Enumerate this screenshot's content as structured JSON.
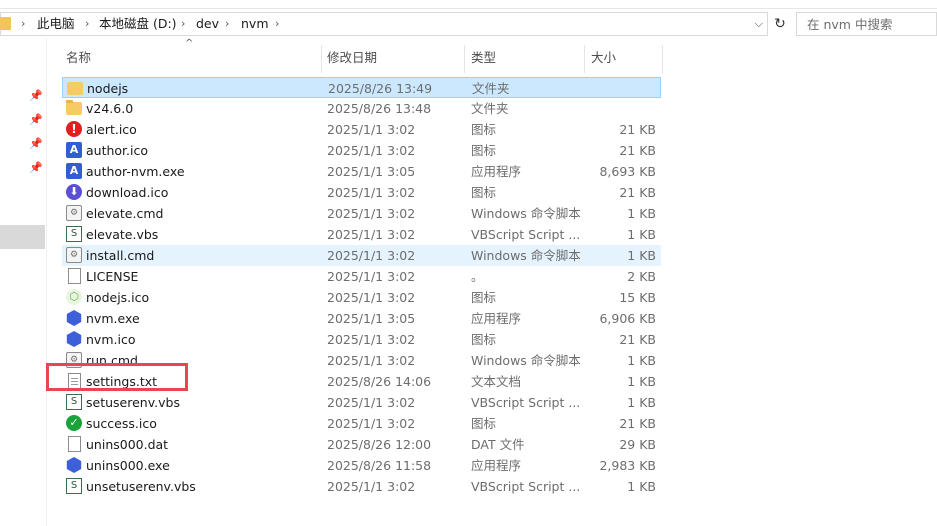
{
  "address": {
    "crumbs": [
      "此电脑",
      "本地磁盘 (D:)",
      "dev",
      "nvm"
    ],
    "separator": "›",
    "dropdown": "⌵"
  },
  "refresh_glyph": "↻",
  "search": {
    "placeholder": "在 nvm 中搜索"
  },
  "columns": {
    "name": "名称",
    "date": "修改日期",
    "type": "类型",
    "size": "大小"
  },
  "files": [
    {
      "name": "nodejs",
      "date": "2025/8/26 13:49",
      "type": "文件夹",
      "size": "",
      "icon": "folder-shortcut-icon",
      "state": "selected"
    },
    {
      "name": "v24.6.0",
      "date": "2025/8/26 13:48",
      "type": "文件夹",
      "size": "",
      "icon": "folder-icon",
      "state": ""
    },
    {
      "name": "alert.ico",
      "date": "2025/1/1 3:02",
      "type": "图标",
      "size": "21 KB",
      "icon": "alert-icon",
      "state": ""
    },
    {
      "name": "author.ico",
      "date": "2025/1/1 3:02",
      "type": "图标",
      "size": "21 KB",
      "icon": "author-icon",
      "state": ""
    },
    {
      "name": "author-nvm.exe",
      "date": "2025/1/1 3:05",
      "type": "应用程序",
      "size": "8,693 KB",
      "icon": "author-exe-icon",
      "state": ""
    },
    {
      "name": "download.ico",
      "date": "2025/1/1 3:02",
      "type": "图标",
      "size": "21 KB",
      "icon": "download-icon",
      "state": ""
    },
    {
      "name": "elevate.cmd",
      "date": "2025/1/1 3:02",
      "type": "Windows 命令脚本",
      "size": "1 KB",
      "icon": "cmd-file-icon",
      "state": ""
    },
    {
      "name": "elevate.vbs",
      "date": "2025/1/1 3:02",
      "type": "VBScript Script ...",
      "size": "1 KB",
      "icon": "vbs-file-icon",
      "state": ""
    },
    {
      "name": "install.cmd",
      "date": "2025/1/1 3:02",
      "type": "Windows 命令脚本",
      "size": "1 KB",
      "icon": "cmd-file-icon",
      "state": "hover"
    },
    {
      "name": "LICENSE",
      "date": "2025/1/1 3:02",
      "type": "。",
      "size": "2 KB",
      "icon": "file-icon",
      "state": ""
    },
    {
      "name": "nodejs.ico",
      "date": "2025/1/1 3:02",
      "type": "图标",
      "size": "15 KB",
      "icon": "nodejs-icon",
      "state": ""
    },
    {
      "name": "nvm.exe",
      "date": "2025/1/1 3:05",
      "type": "应用程序",
      "size": "6,906 KB",
      "icon": "nvm-hex-icon",
      "state": ""
    },
    {
      "name": "nvm.ico",
      "date": "2025/1/1 3:02",
      "type": "图标",
      "size": "21 KB",
      "icon": "nvm-hex-icon",
      "state": ""
    },
    {
      "name": "run.cmd",
      "date": "2025/1/1 3:02",
      "type": "Windows 命令脚本",
      "size": "1 KB",
      "icon": "cmd-file-icon",
      "state": ""
    },
    {
      "name": "settings.txt",
      "date": "2025/8/26 14:06",
      "type": "文本文档",
      "size": "1 KB",
      "icon": "text-file-icon",
      "state": ""
    },
    {
      "name": "setuserenv.vbs",
      "date": "2025/1/1 3:02",
      "type": "VBScript Script ...",
      "size": "1 KB",
      "icon": "vbs-file-icon",
      "state": ""
    },
    {
      "name": "success.ico",
      "date": "2025/1/1 3:02",
      "type": "图标",
      "size": "21 KB",
      "icon": "success-icon",
      "state": ""
    },
    {
      "name": "unins000.dat",
      "date": "2025/8/26 12:00",
      "type": "DAT 文件",
      "size": "29 KB",
      "icon": "file-icon",
      "state": ""
    },
    {
      "name": "unins000.exe",
      "date": "2025/8/26 11:58",
      "type": "应用程序",
      "size": "2,983 KB",
      "icon": "nvm-hex-icon",
      "state": ""
    },
    {
      "name": "unsetuserenv.vbs",
      "date": "2025/1/1 3:02",
      "type": "VBScript Script ...",
      "size": "1 KB",
      "icon": "vbs-file-icon",
      "state": ""
    }
  ]
}
